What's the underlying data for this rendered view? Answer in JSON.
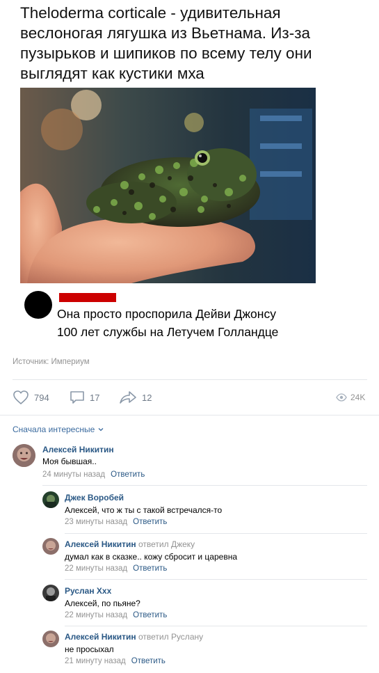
{
  "headline": "Theloderma corticale - удивительная веслоногая лягушка из Вьетнама. Из-за пузырьков и шипиков по всему телу они выглядят как кустики мха",
  "reply_card": {
    "text_line1": "Она просто проспорила Дейви Джонсу",
    "text_line2": "100 лет службы на Летучем Голландце"
  },
  "source": "Источник: Империум",
  "actions": {
    "likes": "794",
    "comments": "17",
    "shares": "12",
    "views": "24K"
  },
  "sort_label": "Сначала интересные",
  "comments": [
    {
      "author": "Алексей Никитин",
      "replied_to": "",
      "text": "Моя бывшая..",
      "time": "24 минуты назад",
      "reply": "Ответить"
    },
    {
      "author": "Джек Воробей",
      "replied_to": "",
      "text": "Алексей, что ж ты с такой встречался-то",
      "time": "23 минуты назад",
      "reply": "Ответить"
    },
    {
      "author": "Алексей Никитин",
      "replied_to": "ответил Джеку",
      "text": "думал как в сказке.. кожу сбросит и царевна",
      "time": "22 минуты назад",
      "reply": "Ответить"
    },
    {
      "author": "Руслан Ххх",
      "replied_to": "",
      "text": "Алексей, по пьяне?",
      "time": "22 минуты назад",
      "reply": "Ответить"
    },
    {
      "author": "Алексей Никитин",
      "replied_to": "ответил Руслану",
      "text": "не просыхал",
      "time": "21 минуту назад",
      "reply": "Ответить"
    }
  ],
  "colors": {
    "link": "#2a5885",
    "meta": "#939393",
    "action_icon": "#6f7a88",
    "redaction": "#cc0000"
  }
}
